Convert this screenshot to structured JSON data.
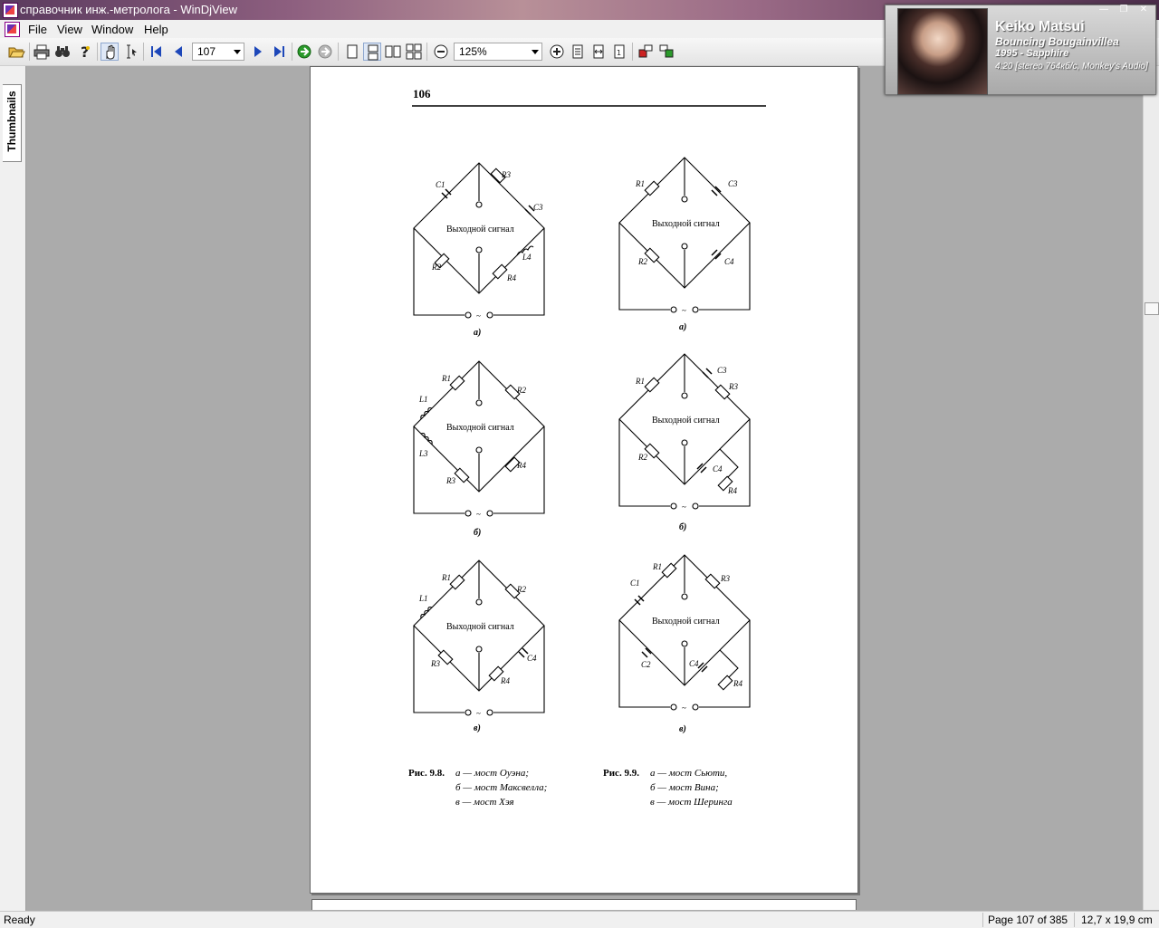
{
  "window": {
    "title": "справочник инж.-метролога - WinDjView"
  },
  "menu": {
    "items": [
      "File",
      "View",
      "Window",
      "Help"
    ]
  },
  "toolbar": {
    "page_number": "107",
    "zoom": "125%"
  },
  "sidebar": {
    "tab_label": "Thumbnails"
  },
  "document": {
    "page_header": "106",
    "output_label": "Выходной сигнал",
    "ac_symbol": "~",
    "left_caps": [
      "а)",
      "б)",
      "в)"
    ],
    "right_caps": [
      "а)",
      "б)",
      "в)"
    ],
    "labels": {
      "l1": [
        "C1",
        "R3",
        "C3",
        "R2",
        "R4",
        "L4"
      ],
      "r1": [
        "R1",
        "C3",
        "R2",
        "C4"
      ],
      "l2": [
        "R1",
        "R2",
        "L1",
        "L3",
        "R3",
        "R4"
      ],
      "r2": [
        "R1",
        "C3",
        "R3",
        "R2",
        "C4",
        "R4"
      ],
      "l3": [
        "R1",
        "R2",
        "L1",
        "R3",
        "R4",
        "C4"
      ],
      "r3": [
        "C1",
        "R1",
        "R3",
        "C2",
        "C4",
        "R4"
      ]
    },
    "caption_left": {
      "label": "Рис. 9.8.",
      "lines": [
        "а — мост Оуэна;",
        "б — мост Максвелла;",
        "в — мост Хэя"
      ]
    },
    "caption_right": {
      "label": "Рис. 9.9.",
      "lines": [
        "а — мост Сьюти,",
        "б — мост Вина;",
        "в — мост Шеринга"
      ]
    }
  },
  "status": {
    "state": "Ready",
    "page": "Page 107 of 385",
    "size": "12,7 x 19,9 cm"
  },
  "now_playing": {
    "artist": "Keiko Matsui",
    "song": "Bouncing Bougainvillea",
    "album": "1995 - Sapphire",
    "info": "4:20 [stereo 764кб/с, Monkey's Audio]"
  }
}
